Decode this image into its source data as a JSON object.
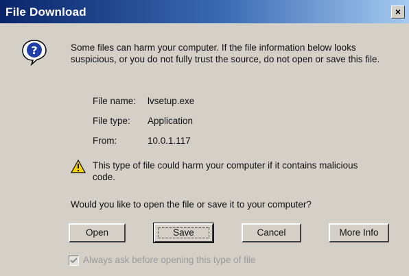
{
  "window": {
    "title": "File Download",
    "close_glyph": "×",
    "title_bar_color_start": "#0a246a",
    "title_bar_color_end": "#a6caf0"
  },
  "icons": {
    "question": "question-icon",
    "warning": "warning-icon"
  },
  "intro_text": "Some files can harm your computer. If the file information below looks suspicious, or you do not fully trust the source, do not open or save this file.",
  "file_info": {
    "name_label": "File name:",
    "name_value": "lvsetup.exe",
    "type_label": "File type:",
    "type_value": "Application",
    "from_label": "From:",
    "from_value": "10.0.1.117"
  },
  "warning_text": "This type of file could harm your computer if it contains malicious code.",
  "question": "Would you like to open the file or save it to your computer?",
  "buttons": {
    "open": "Open",
    "save": "Save",
    "cancel": "Cancel",
    "more_info": "More Info"
  },
  "checkbox": {
    "label": "Always ask before opening this type of file",
    "checked": true,
    "enabled": false
  }
}
